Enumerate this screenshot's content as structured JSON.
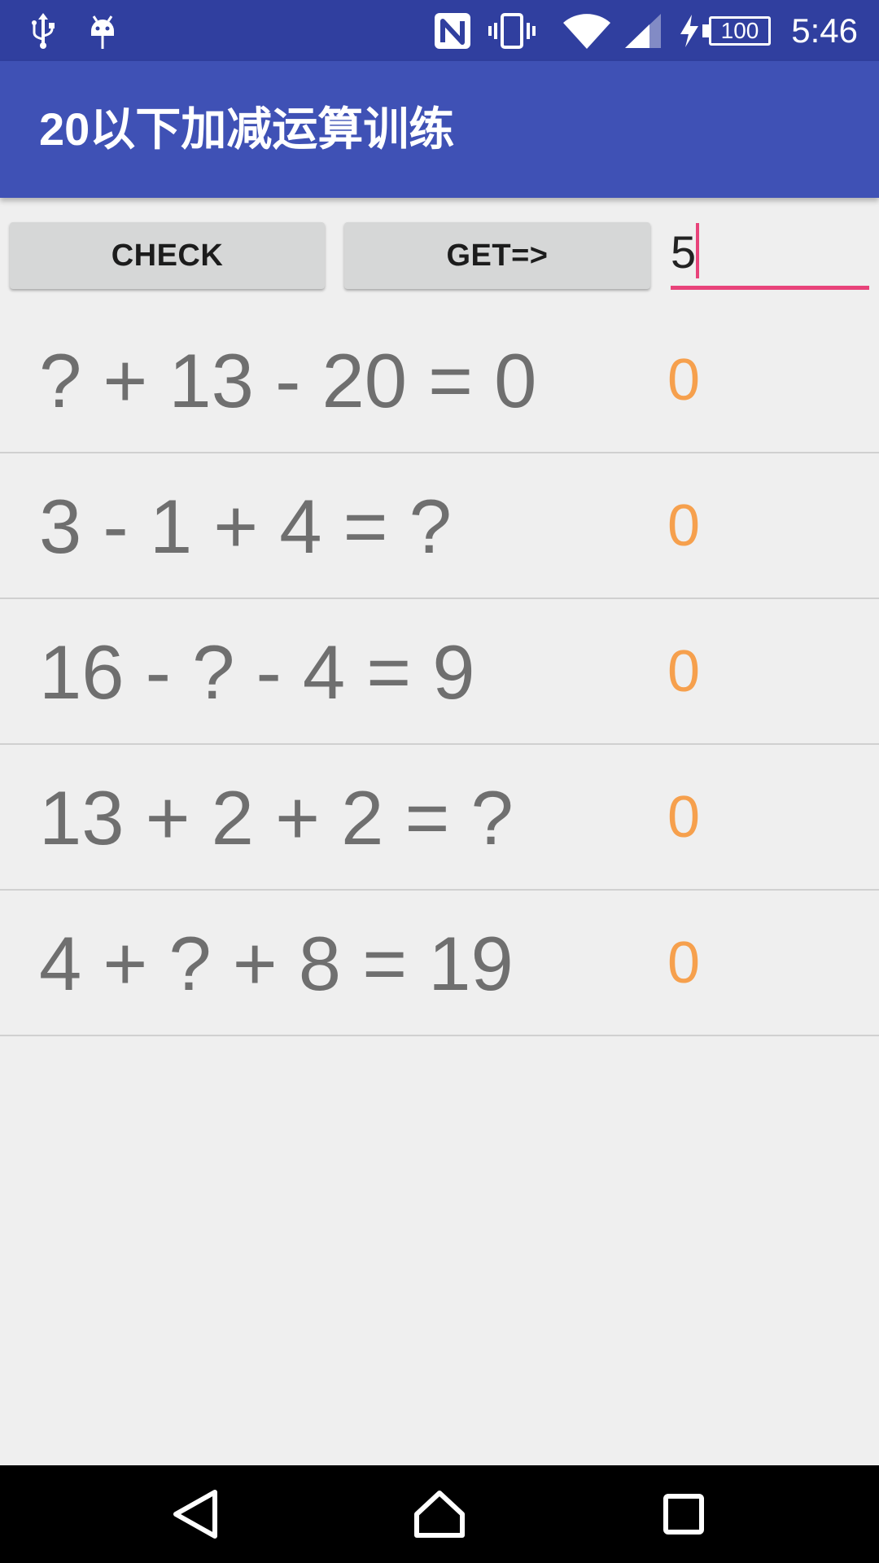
{
  "status_bar": {
    "time": "5:46",
    "battery_level": "100",
    "icons": [
      "usb-icon",
      "android-debug-icon",
      "nfc-icon",
      "vibrate-icon",
      "wifi-icon",
      "signal-icon",
      "charging-icon",
      "battery-icon"
    ]
  },
  "app_bar": {
    "title": "20以下加减运算训练",
    "color": "#3f51b5"
  },
  "controls": {
    "check_label": "CHECK",
    "get_label": "GET=>",
    "input_value": "5",
    "accent_color": "#e8437a"
  },
  "problems": [
    {
      "expression": "? + 13 - 20 = 0",
      "answer": "0"
    },
    {
      "expression": "3 - 1 + 4 = ?",
      "answer": "0"
    },
    {
      "expression": "16 - ? - 4 = 9",
      "answer": "0"
    },
    {
      "expression": "13 + 2 + 2 = ?",
      "answer": "0"
    },
    {
      "expression": "4 + ? + 8 = 19",
      "answer": "0"
    }
  ],
  "nav_bar": {
    "buttons": [
      "back-icon",
      "home-icon",
      "recents-icon"
    ]
  }
}
